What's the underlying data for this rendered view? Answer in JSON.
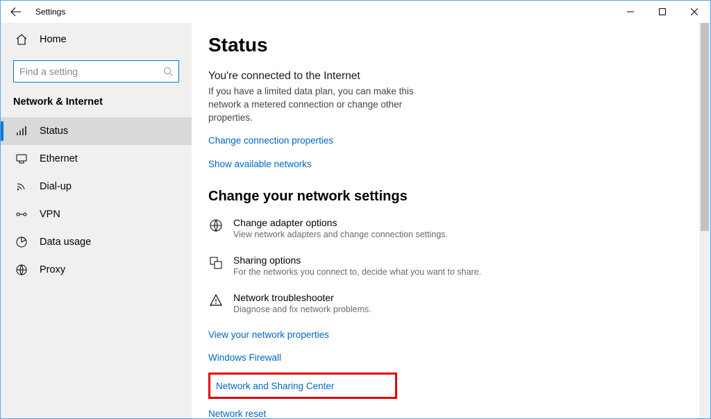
{
  "window": {
    "title": "Settings"
  },
  "sidebar": {
    "home": "Home",
    "search_placeholder": "Find a setting",
    "category": "Network & Internet",
    "items": [
      {
        "label": "Status",
        "icon": "status-icon",
        "selected": true
      },
      {
        "label": "Ethernet",
        "icon": "ethernet-icon",
        "selected": false
      },
      {
        "label": "Dial-up",
        "icon": "dialup-icon",
        "selected": false
      },
      {
        "label": "VPN",
        "icon": "vpn-icon",
        "selected": false
      },
      {
        "label": "Data usage",
        "icon": "data-icon",
        "selected": false
      },
      {
        "label": "Proxy",
        "icon": "proxy-icon",
        "selected": false
      }
    ]
  },
  "main": {
    "heading": "Status",
    "connected_title": "You're connected to the Internet",
    "connected_desc": "If you have a limited data plan, you can make this network a metered connection or change other properties.",
    "link_change_props": "Change connection properties",
    "link_show_networks": "Show available networks",
    "change_settings_heading": "Change your network settings",
    "options": [
      {
        "title": "Change adapter options",
        "desc": "View network adapters and change connection settings.",
        "icon": "adapter-icon"
      },
      {
        "title": "Sharing options",
        "desc": "For the networks you connect to, decide what you want to share.",
        "icon": "sharing-icon"
      },
      {
        "title": "Network troubleshooter",
        "desc": "Diagnose and fix network problems.",
        "icon": "troubleshoot-icon"
      }
    ],
    "link_view_props": "View your network properties",
    "link_firewall": "Windows Firewall",
    "link_sharing_center": "Network and Sharing Center",
    "link_reset": "Network reset"
  }
}
